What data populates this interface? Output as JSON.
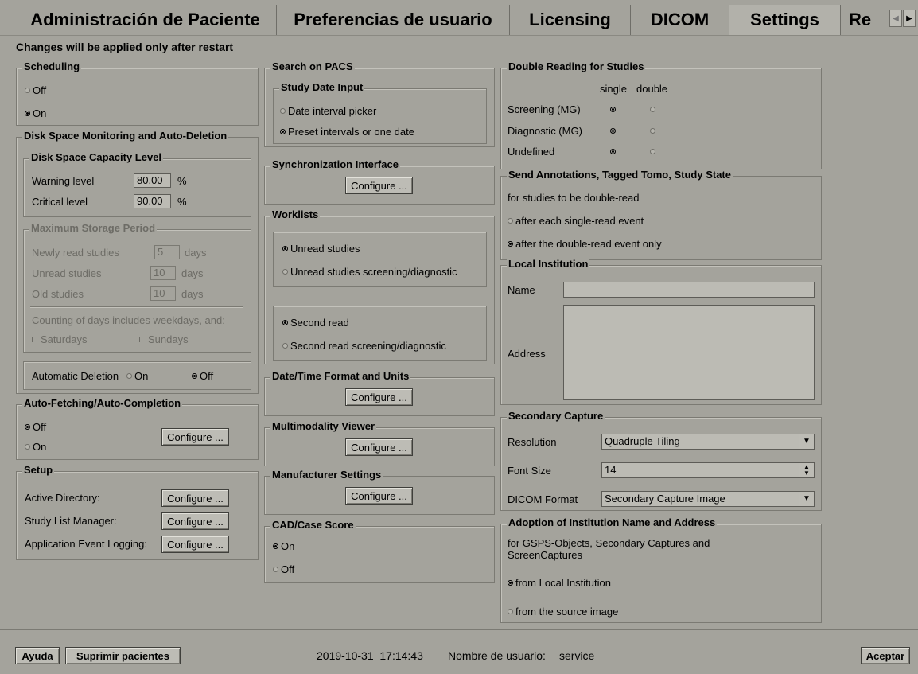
{
  "tabs": {
    "patient_admin": "Administración de Paciente",
    "user_prefs": "Preferencias de usuario",
    "licensing": "Licensing",
    "dicom": "DICOM",
    "settings": "Settings",
    "partial": "Re"
  },
  "notice": "Changes will be applied only after restart",
  "scheduling": {
    "title": "Scheduling",
    "off": "Off",
    "on": "On",
    "selected": "On"
  },
  "disk": {
    "title": "Disk Space Monitoring and Auto-Deletion",
    "capacity": {
      "title": "Disk Space Capacity Level",
      "warning_label": "Warning level",
      "warning_value": "80.00",
      "warning_unit": "%",
      "critical_label": "Critical level",
      "critical_value": "90.00",
      "critical_unit": "%"
    },
    "storage": {
      "title": "Maximum Storage Period",
      "newly_label": "Newly read studies",
      "newly_value": "5",
      "newly_unit": "days",
      "unread_label": "Unread studies",
      "unread_value": "10",
      "unread_unit": "days",
      "old_label": "Old studies",
      "old_value": "10",
      "old_unit": "days",
      "counting": "Counting of days includes weekdays, and:",
      "saturdays": "Saturdays",
      "sundays": "Sundays"
    },
    "auto_delete": {
      "label": "Automatic Deletion",
      "on": "On",
      "off": "Off",
      "selected": "Off"
    }
  },
  "autofetch": {
    "title": "Auto-Fetching/Auto-Completion",
    "off": "Off",
    "on": "On",
    "selected": "Off",
    "configure": "Configure ..."
  },
  "setup": {
    "title": "Setup",
    "rows": [
      {
        "label": "Active Directory:",
        "button": "Configure ..."
      },
      {
        "label": "Study List Manager:",
        "button": "Configure ..."
      },
      {
        "label": "Application Event Logging:",
        "button": "Configure ..."
      }
    ]
  },
  "pacs": {
    "title": "Search on PACS",
    "date_input": {
      "title": "Study Date Input",
      "opt1": "Date interval picker",
      "opt2": "Preset intervals or one date",
      "selected": "Preset intervals or one date"
    }
  },
  "sync": {
    "title": "Synchronization Interface",
    "configure": "Configure ..."
  },
  "worklists": {
    "title": "Worklists",
    "unread": "Unread studies",
    "unread_sd": "Unread studies screening/diagnostic",
    "second": "Second read",
    "second_sd": "Second read screening/diagnostic"
  },
  "datetime": {
    "title": "Date/Time Format and Units",
    "configure": "Configure ..."
  },
  "mmv": {
    "title": "Multimodality Viewer",
    "configure": "Configure ..."
  },
  "manufacturer": {
    "title": "Manufacturer Settings",
    "configure": "Configure ..."
  },
  "cad": {
    "title": "CAD/Case Score",
    "on": "On",
    "off": "Off",
    "selected": "On"
  },
  "double_reading": {
    "title": "Double Reading for Studies",
    "col_single": "single",
    "col_double": "double",
    "rows": [
      {
        "label": "Screening (MG)",
        "selected": "single"
      },
      {
        "label": "Diagnostic (MG)",
        "selected": "single"
      },
      {
        "label": "Undefined",
        "selected": "single"
      }
    ]
  },
  "send_annotations": {
    "title": "Send Annotations, Tagged Tomo, Study State",
    "subtitle": "for studies to be double-read",
    "opt1": "after each single-read event",
    "opt2": "after the double-read event only",
    "selected": "after the double-read event only"
  },
  "local_institution": {
    "title": "Local Institution",
    "name_label": "Name",
    "name_value": "",
    "address_label": "Address",
    "address_value": ""
  },
  "secondary_capture": {
    "title": "Secondary Capture",
    "resolution_label": "Resolution",
    "resolution_value": "Quadruple Tiling",
    "fontsize_label": "Font Size",
    "fontsize_value": "14",
    "dicom_label": "DICOM Format",
    "dicom_value": "Secondary Capture Image"
  },
  "adoption": {
    "title": "Adoption of Institution Name and Address",
    "desc1": "for GSPS-Objects, Secondary Captures and",
    "desc2": "ScreenCaptures",
    "opt1": "from Local Institution",
    "opt2": "from the source image",
    "selected": "from Local Institution"
  },
  "footer": {
    "help": "Ayuda",
    "delete_patients": "Suprimir pacientes",
    "datetime": "2019-10-31  17:14:43",
    "user_label": "Nombre de usuario:",
    "user": "service",
    "accept": "Aceptar"
  }
}
